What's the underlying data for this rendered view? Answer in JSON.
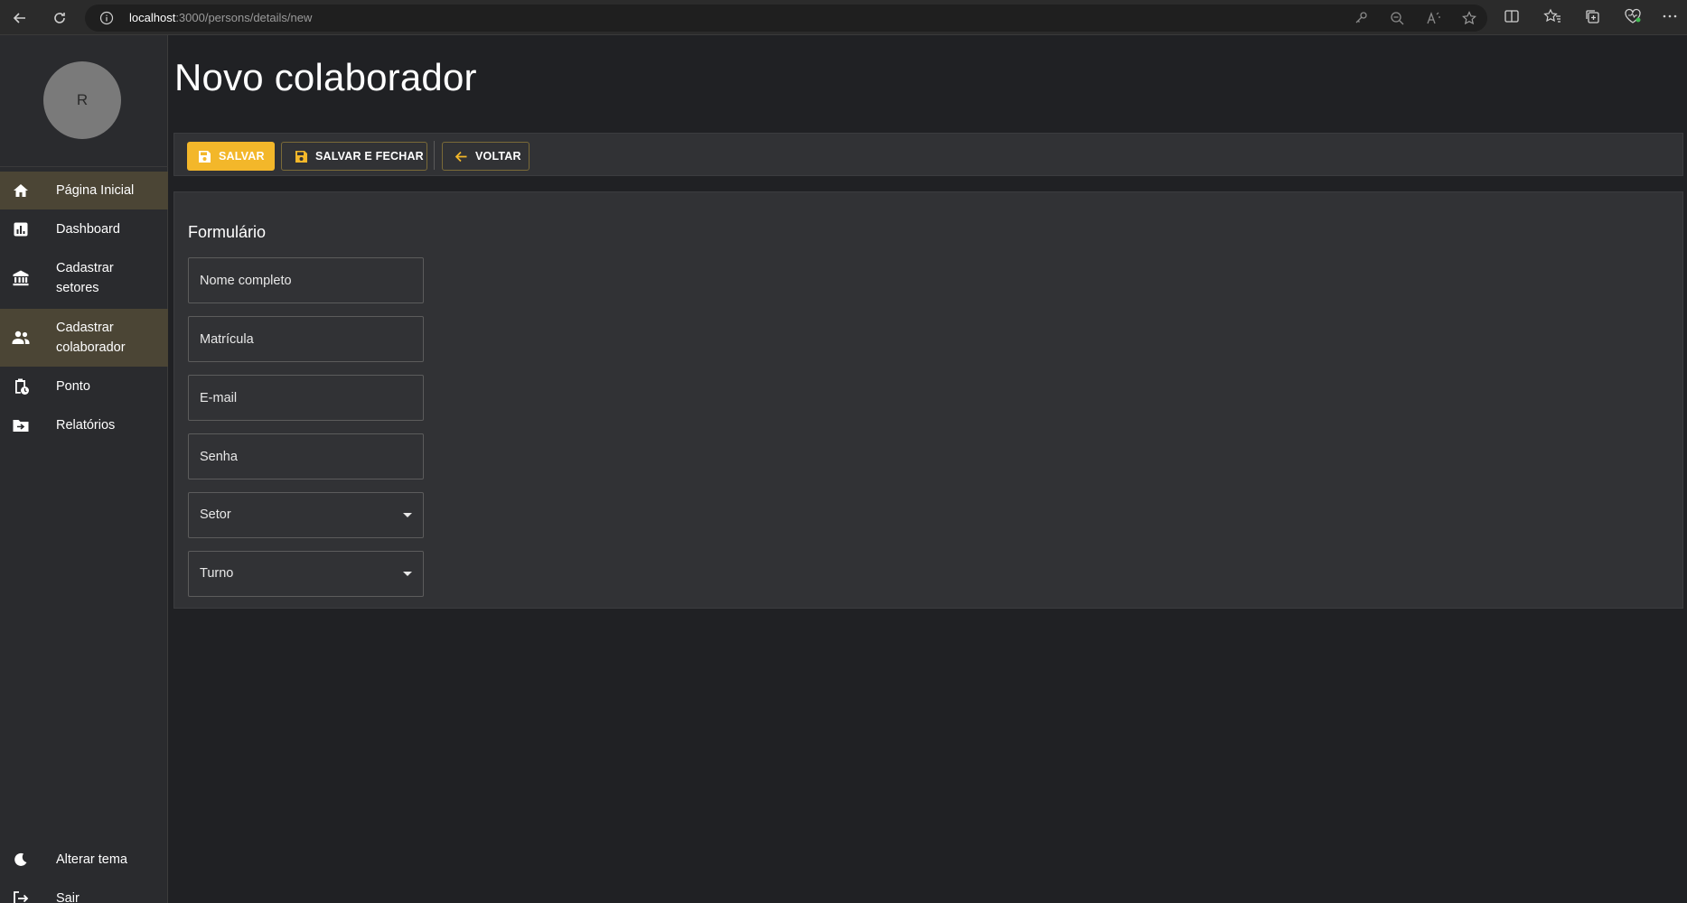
{
  "browser": {
    "url_host": "localhost",
    "url_path": ":3000/persons/details/new"
  },
  "sidebar": {
    "avatar_initial": "R",
    "items": [
      {
        "label": "Página Inicial",
        "icon": "home-icon",
        "active": true
      },
      {
        "label": "Dashboard",
        "icon": "chart-icon",
        "active": false
      },
      {
        "label": "Cadastrar setores",
        "icon": "bank-icon",
        "active": false
      },
      {
        "label": "Cadastrar colaborador",
        "icon": "people-icon",
        "active": true
      },
      {
        "label": "Ponto",
        "icon": "clipboard-clock-icon",
        "active": false
      },
      {
        "label": "Relatórios",
        "icon": "folder-arrow-icon",
        "active": false
      }
    ],
    "bottom_items": [
      {
        "label": "Alterar tema",
        "icon": "moon-icon"
      },
      {
        "label": "Sair",
        "icon": "logout-icon"
      }
    ]
  },
  "page": {
    "title": "Novo colaborador"
  },
  "toolbar": {
    "save_label": "SALVAR",
    "save_close_label": "SALVAR E FECHAR",
    "back_label": "VOLTAR"
  },
  "form": {
    "title": "Formulário",
    "fields": {
      "full_name": {
        "placeholder": "Nome completo",
        "value": ""
      },
      "registration": {
        "placeholder": "Matrícula",
        "value": ""
      },
      "email": {
        "placeholder": "E-mail",
        "value": ""
      },
      "password": {
        "placeholder": "Senha",
        "value": ""
      },
      "sector": {
        "label": "Setor"
      },
      "shift": {
        "label": "Turno"
      }
    }
  },
  "colors": {
    "accent": "#f3b72a",
    "active_menu_bg": "#4b4535",
    "background": "#202124",
    "panel": "#313235"
  }
}
